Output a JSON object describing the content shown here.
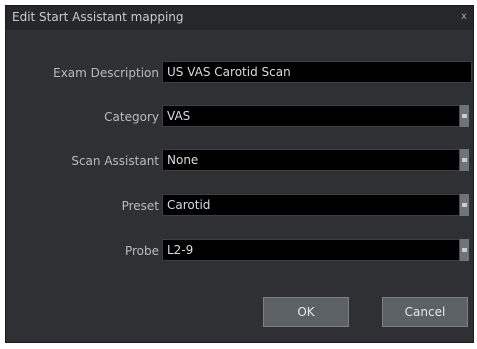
{
  "dialog": {
    "title": "Edit Start Assistant mapping",
    "close_glyph": "x",
    "close_icon": "close-icon"
  },
  "fields": {
    "exam_description": {
      "label": "Exam Description",
      "value": "US VAS Carotid Scan"
    },
    "category": {
      "label": "Category",
      "value": "VAS"
    },
    "scan_assistant": {
      "label": "Scan Assistant",
      "value": "None"
    },
    "preset": {
      "label": "Preset",
      "value": "Carotid"
    },
    "probe": {
      "label": "Probe",
      "value": "L2-9"
    }
  },
  "buttons": {
    "ok": "OK",
    "cancel": "Cancel"
  }
}
